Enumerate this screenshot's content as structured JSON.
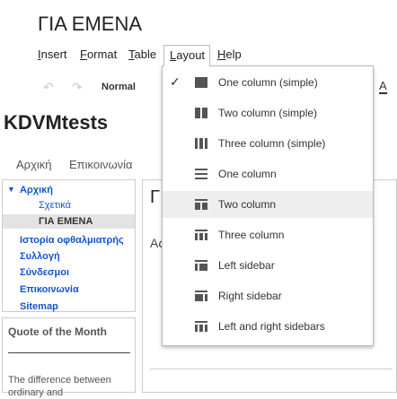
{
  "document": {
    "title": "ΓΙΑ ΕΜΕΝΑ"
  },
  "menubar": {
    "items": [
      {
        "label": "Insert",
        "underline": "I",
        "rest": "nsert"
      },
      {
        "label": "Format",
        "underline": "F",
        "rest": "ormat"
      },
      {
        "label": "Table",
        "underline": "T",
        "rest": "able"
      },
      {
        "label": "Layout",
        "underline": "L",
        "rest": "ayout"
      },
      {
        "label": "Help",
        "underline": "H",
        "rest": "elp"
      }
    ]
  },
  "toolbar": {
    "style_value": "Normal",
    "font_color_glyph": "A"
  },
  "site": {
    "title": "KDVMtests"
  },
  "top_nav": {
    "items": [
      "Αρχική",
      "Επικοινωνία"
    ]
  },
  "sidebar_nav": {
    "home": "Αρχική",
    "sub1": "Σχετικά",
    "current": "ΓΙΑ ΕΜΕΝΑ",
    "items": [
      "Ιστορία οφθαλμιατρής",
      "Συλλογή",
      "Σύνδεσμοι",
      "Επικοινωνία",
      "Sitemap"
    ]
  },
  "quote_box": {
    "title": "Quote of the Month",
    "text": "The difference between ordinary and"
  },
  "content": {
    "heading": "Γ",
    "text": "Ας"
  },
  "layout_menu": {
    "checked_index": 0,
    "highlighted_index": 4,
    "items": [
      {
        "label": "One column (simple)",
        "icon": "one-column-simple-icon"
      },
      {
        "label": "Two column (simple)",
        "icon": "two-column-simple-icon"
      },
      {
        "label": "Three column (simple)",
        "icon": "three-column-simple-icon"
      },
      {
        "label": "One column",
        "icon": "one-column-icon"
      },
      {
        "label": "Two column",
        "icon": "two-column-icon"
      },
      {
        "label": "Three column",
        "icon": "three-column-icon"
      },
      {
        "label": "Left sidebar",
        "icon": "left-sidebar-icon"
      },
      {
        "label": "Right sidebar",
        "icon": "right-sidebar-icon"
      },
      {
        "label": "Left and right sidebars",
        "icon": "left-right-sidebars-icon"
      }
    ]
  },
  "colors": {
    "link": "#1155cc",
    "highlight": "#eeeeee",
    "current_page_bg": "#e3e3e3"
  }
}
